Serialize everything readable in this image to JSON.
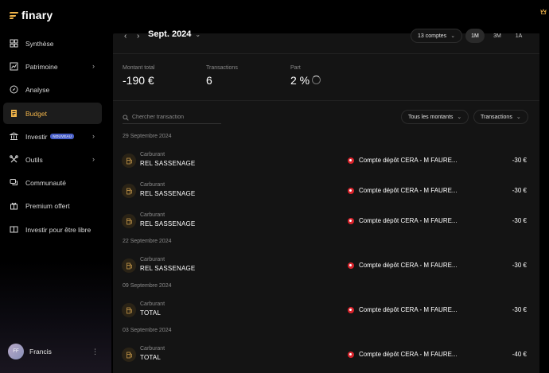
{
  "app": {
    "logo": "finary"
  },
  "sidebar": {
    "items": [
      {
        "label": "Synthèse",
        "icon": "grid-icon",
        "chevron": false,
        "active": false
      },
      {
        "label": "Patrimoine",
        "icon": "chart-icon",
        "chevron": true,
        "active": false
      },
      {
        "label": "Analyse",
        "icon": "compass-icon",
        "chevron": false,
        "active": false
      },
      {
        "label": "Budget",
        "icon": "receipt-icon",
        "chevron": false,
        "active": true
      },
      {
        "label": "Investir",
        "icon": "bank-icon",
        "chevron": true,
        "active": false,
        "badge": "NOUVEAU"
      },
      {
        "label": "Outils",
        "icon": "tools-icon",
        "chevron": true,
        "active": false
      },
      {
        "label": "Communauté",
        "icon": "chat-icon",
        "chevron": false,
        "active": false
      },
      {
        "label": "Premium offert",
        "icon": "gift-icon",
        "chevron": false,
        "active": false
      },
      {
        "label": "Investir pour être libre",
        "icon": "book-icon",
        "chevron": false,
        "active": false
      }
    ],
    "user": {
      "initials": "FF",
      "name": "Francis",
      "menu": "⋮"
    }
  },
  "header": {
    "prev": "‹",
    "next": "›",
    "month": "Sept. 2024",
    "accounts_filter": "13 comptes",
    "periods": [
      "1M",
      "3M",
      "1A"
    ],
    "active_period": "1M"
  },
  "stats": [
    {
      "label": "Montant total",
      "value": "-190 €"
    },
    {
      "label": "Transactions",
      "value": "6"
    },
    {
      "label": "Part",
      "value": "2 %"
    }
  ],
  "search": {
    "placeholder": "Chercher transaction"
  },
  "filters": {
    "amounts": "Tous les montants",
    "type": "Transactions"
  },
  "groups": [
    {
      "date": "29 Septembre 2024",
      "transactions": [
        {
          "category": "Carburant",
          "name": "REL SASSENAGE",
          "account": "Compte dépôt CERA - M FAURE...",
          "amount": "-30 €"
        },
        {
          "category": "Carburant",
          "name": "REL SASSENAGE",
          "account": "Compte dépôt CERA - M FAURE...",
          "amount": "-30 €"
        },
        {
          "category": "Carburant",
          "name": "REL SASSENAGE",
          "account": "Compte dépôt CERA - M FAURE...",
          "amount": "-30 €"
        }
      ]
    },
    {
      "date": "22 Septembre 2024",
      "transactions": [
        {
          "category": "Carburant",
          "name": "REL SASSENAGE",
          "account": "Compte dépôt CERA - M FAURE...",
          "amount": "-30 €"
        }
      ]
    },
    {
      "date": "09 Septembre 2024",
      "transactions": [
        {
          "category": "Carburant",
          "name": "TOTAL",
          "account": "Compte dépôt CERA - M FAURE...",
          "amount": "-30 €"
        }
      ]
    },
    {
      "date": "03 Septembre 2024",
      "transactions": [
        {
          "category": "Carburant",
          "name": "TOTAL",
          "account": "Compte dépôt CERA - M FAURE...",
          "amount": "-40 €"
        }
      ]
    }
  ],
  "colors": {
    "accent": "#f0b44a",
    "bank_red": "#d8242c",
    "panel": "#141414",
    "badge": "#4a60c8"
  }
}
